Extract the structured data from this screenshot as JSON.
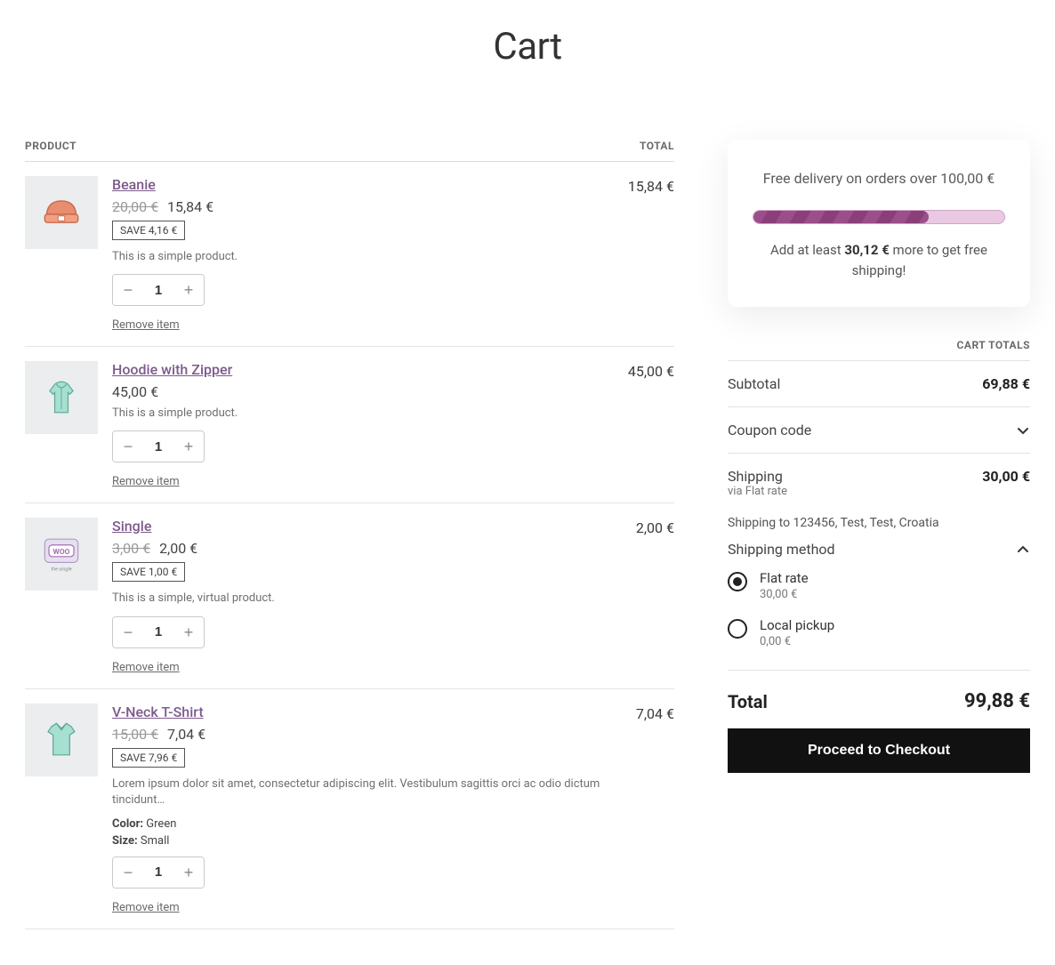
{
  "page": {
    "title": "Cart"
  },
  "headers": {
    "product": "PRODUCT",
    "total": "TOTAL"
  },
  "remove_label": "Remove item",
  "items": [
    {
      "name": "Beanie",
      "old_price": "20,00 €",
      "price": "15,84 €",
      "save": "SAVE 4,16 €",
      "desc": "This is a simple product.",
      "qty": "1",
      "line_total": "15,84 €"
    },
    {
      "name": "Hoodie with Zipper",
      "price": "45,00 €",
      "desc": "This is a simple product.",
      "qty": "1",
      "line_total": "45,00 €"
    },
    {
      "name": "Single",
      "old_price": "3,00 €",
      "price": "2,00 €",
      "save": "SAVE 1,00 €",
      "desc": "This is a simple, virtual product.",
      "qty": "1",
      "line_total": "2,00 €"
    },
    {
      "name": "V-Neck T-Shirt",
      "old_price": "15,00 €",
      "price": "7,04 €",
      "save": "SAVE 7,96 €",
      "desc": "Lorem ipsum dolor sit amet, consectetur adipiscing elit. Vestibulum sagittis orci ac odio dictum tincidunt…",
      "color_label": "Color:",
      "color_val": "Green",
      "size_label": "Size:",
      "size_val": "Small",
      "qty": "1",
      "line_total": "7,04 €"
    }
  ],
  "free_ship": {
    "title": "Free delivery on orders over 100,00 €",
    "progress_pct": 70,
    "msg_pre": "Add at least ",
    "msg_amt": "30,12 €",
    "msg_post": " more to get free shipping!"
  },
  "totals": {
    "heading": "CART TOTALS",
    "subtotal_label": "Subtotal",
    "subtotal": "69,88 €",
    "coupon_label": "Coupon code",
    "shipping_label": "Shipping",
    "shipping_via": "via Flat rate",
    "shipping_amount": "30,00 €",
    "shipping_dest": "Shipping to 123456, Test, Test, Croatia",
    "shipping_method_label": "Shipping method",
    "methods": [
      {
        "name": "Flat rate",
        "price": "30,00 €",
        "selected": true
      },
      {
        "name": "Local pickup",
        "price": "0,00 €",
        "selected": false
      }
    ],
    "total_label": "Total",
    "total": "99,88 €",
    "checkout": "Proceed to Checkout"
  },
  "colors": {
    "accent": "#7d5a8c",
    "progress": "#9b4f8a"
  }
}
